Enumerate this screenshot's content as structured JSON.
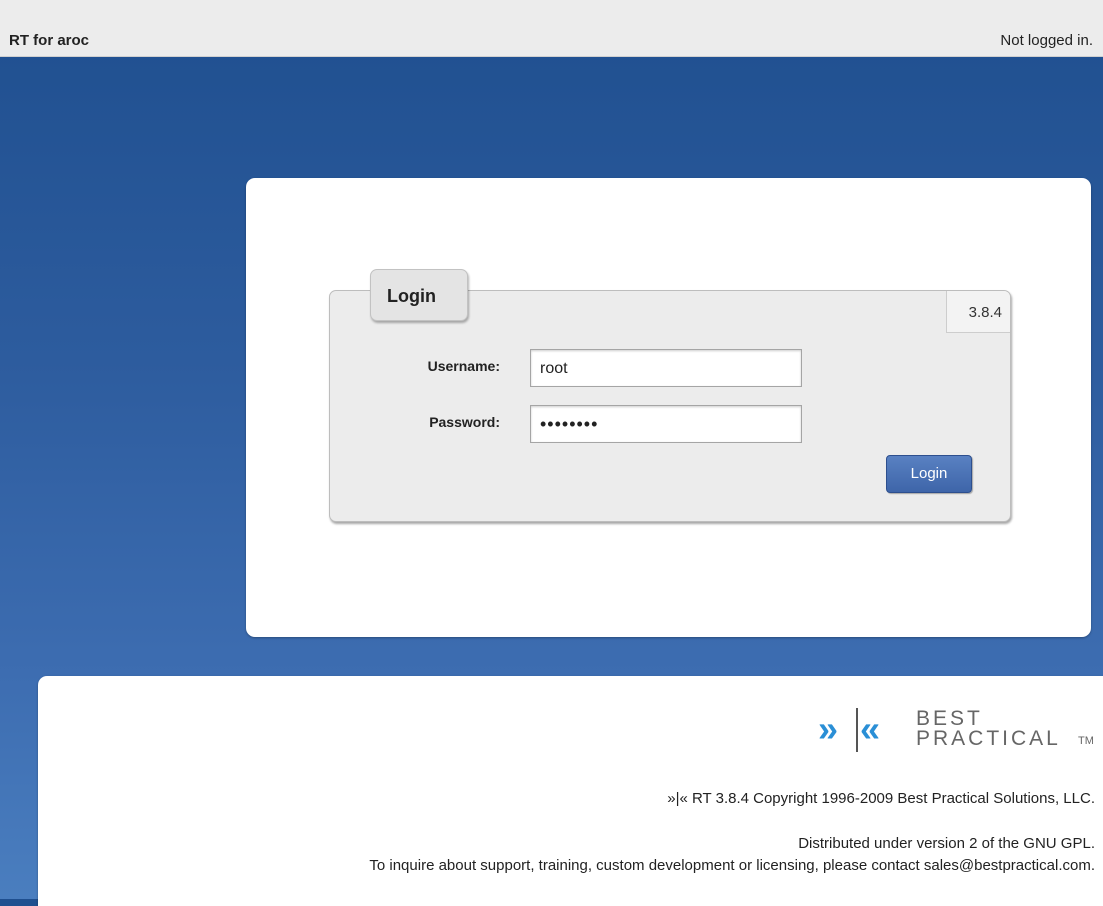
{
  "header": {
    "app_title": "RT for aroc",
    "login_status": "Not logged in."
  },
  "login": {
    "tab_label": "Login",
    "version": "3.8.4",
    "username_label": "Username:",
    "username_value": "root",
    "password_label": "Password:",
    "password_value": "••••••••",
    "submit_label": "Login"
  },
  "footer": {
    "logo": {
      "mark_left": "»",
      "mark_right": "«",
      "line1": "BEST",
      "line2": "PRACTICAL",
      "tm": "TM"
    },
    "copyright": "»|« RT 3.8.4 Copyright 1996-2009 Best Practical Solutions, LLC.",
    "license": "Distributed under version 2 of the GNU GPL.",
    "contact": "To inquire about support, training, custom development or licensing, please contact sales@bestpractical.com."
  },
  "colors": {
    "background_top": "#1f4f8f",
    "background_bottom": "#4a7ebf",
    "button": "#3e65a9",
    "logo_accent": "#2a8fd6"
  }
}
